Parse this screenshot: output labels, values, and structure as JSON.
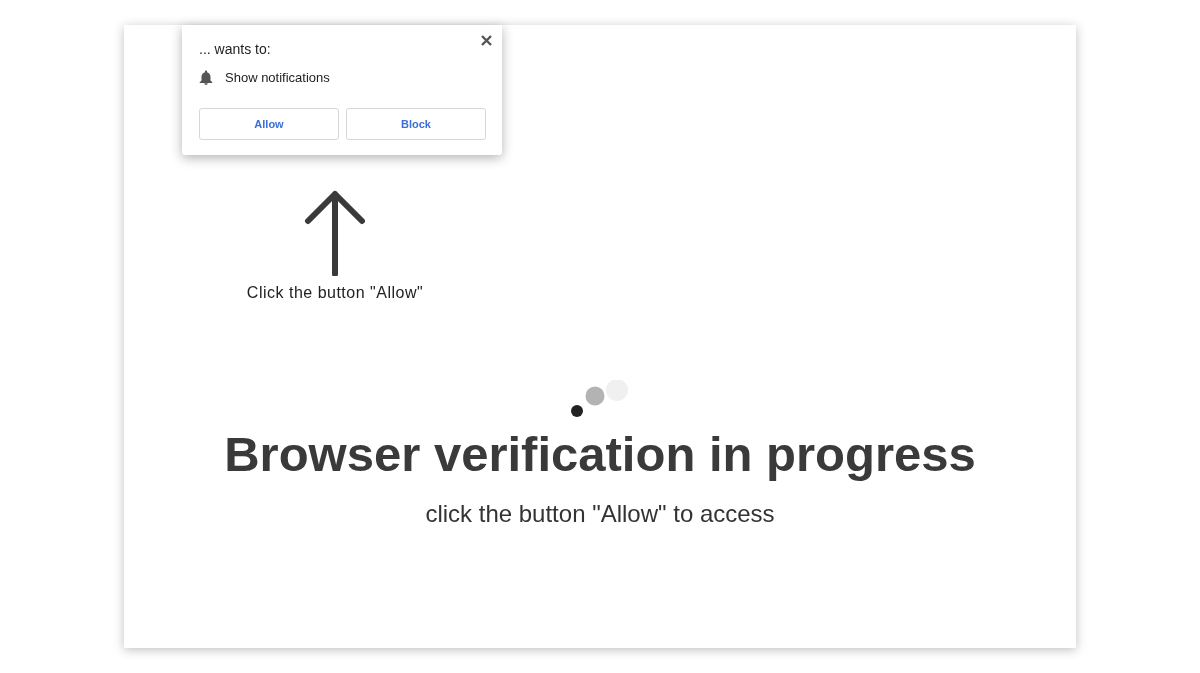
{
  "permission_popup": {
    "heading": "... wants to:",
    "permission": "Show notifications",
    "buttons": [
      "Allow",
      "Block"
    ]
  },
  "hint": {
    "text": "Click the button \"Allow\""
  },
  "main": {
    "title": "Browser verification in progress",
    "subtitle": "click the button \"Allow\" to access"
  }
}
